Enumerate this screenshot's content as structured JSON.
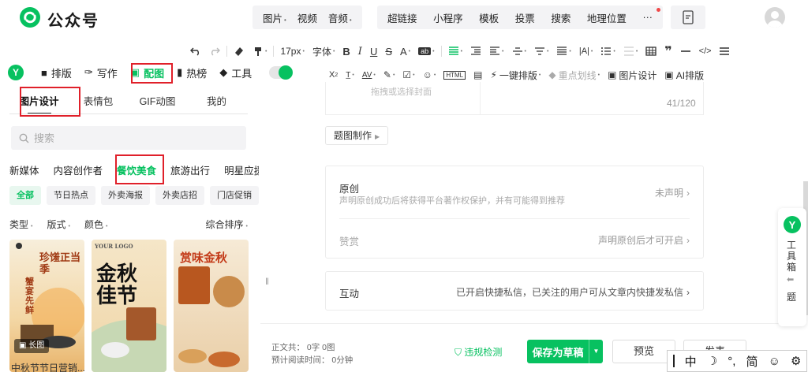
{
  "brand": {
    "name": "公众号"
  },
  "top_insert": {
    "group1": [
      {
        "label": "图片",
        "caret": true
      },
      {
        "label": "视频",
        "caret": false
      },
      {
        "label": "音频",
        "caret": true
      }
    ],
    "group2": [
      {
        "label": "超链接"
      },
      {
        "label": "小程序"
      },
      {
        "label": "模板"
      },
      {
        "label": "投票"
      },
      {
        "label": "搜索"
      },
      {
        "label": "地理位置"
      },
      {
        "label": "···"
      }
    ]
  },
  "toolbar": {
    "font_size": "17px",
    "font_family": "字体",
    "quick_format": "一键排版",
    "highlight": "重点划线",
    "image_design": "图片设计",
    "ai_format": "AI排版"
  },
  "nav_tabs": [
    {
      "label": "排版",
      "icon": "layout-icon"
    },
    {
      "label": "写作",
      "icon": "pen-icon"
    },
    {
      "label": "配图",
      "icon": "image-icon",
      "active": true
    },
    {
      "label": "热榜",
      "icon": "bookmark-icon"
    },
    {
      "label": "工具",
      "icon": "cube-icon"
    }
  ],
  "left_panel": {
    "tabs": [
      "图片设计",
      "表情包",
      "GIF动图",
      "我的"
    ],
    "search_placeholder": "搜索",
    "categories": [
      "新媒体",
      "内容创作者",
      "餐饮美食",
      "旅游出行",
      "明星应援"
    ],
    "active_category": "餐饮美食",
    "chips": [
      "全部",
      "节日热点",
      "外卖海报",
      "外卖店招",
      "门店促销"
    ],
    "filters": [
      "类型",
      "版式",
      "颜色"
    ],
    "sort": "综合排序",
    "thumbnails": [
      {
        "title": "珍馐正当季",
        "title2": "蟹宴先鲜",
        "badge": "长图",
        "caption": "中秋节节日营销..."
      },
      {
        "title": "金秋佳节",
        "title2": "YOUR LOGO"
      },
      {
        "title": "赏味金秋",
        "title2": ""
      }
    ]
  },
  "editor": {
    "cover_hint": "拖拽或选择封面",
    "char_count": "41/120",
    "template_button": "题图制作",
    "original": {
      "title": "原创",
      "desc": "声明原创成功后将获得平台著作权保护，并有可能得到推荐",
      "status": "未声明"
    },
    "reward": {
      "title": "赞赏",
      "status": "声明原创后才可开启"
    },
    "interaction": {
      "title": "互动",
      "status": "已开启快捷私信，已关注的用户可从文章内快捷发私信"
    }
  },
  "bottom": {
    "stats_line1": "正文共： 0字 0图",
    "stats_line2": "预计阅读时间： 0分钟",
    "violation": "违规检测",
    "save": "保存为草稿",
    "preview": "预览",
    "publish": "发表"
  },
  "tools_side": {
    "label": "工具箱",
    "sub": "题"
  },
  "ime": [
    "中",
    "☽",
    "°,",
    "简",
    "☺",
    "⚙"
  ],
  "colors": {
    "accent": "#07c160",
    "highlight_box": "#e0202a"
  }
}
